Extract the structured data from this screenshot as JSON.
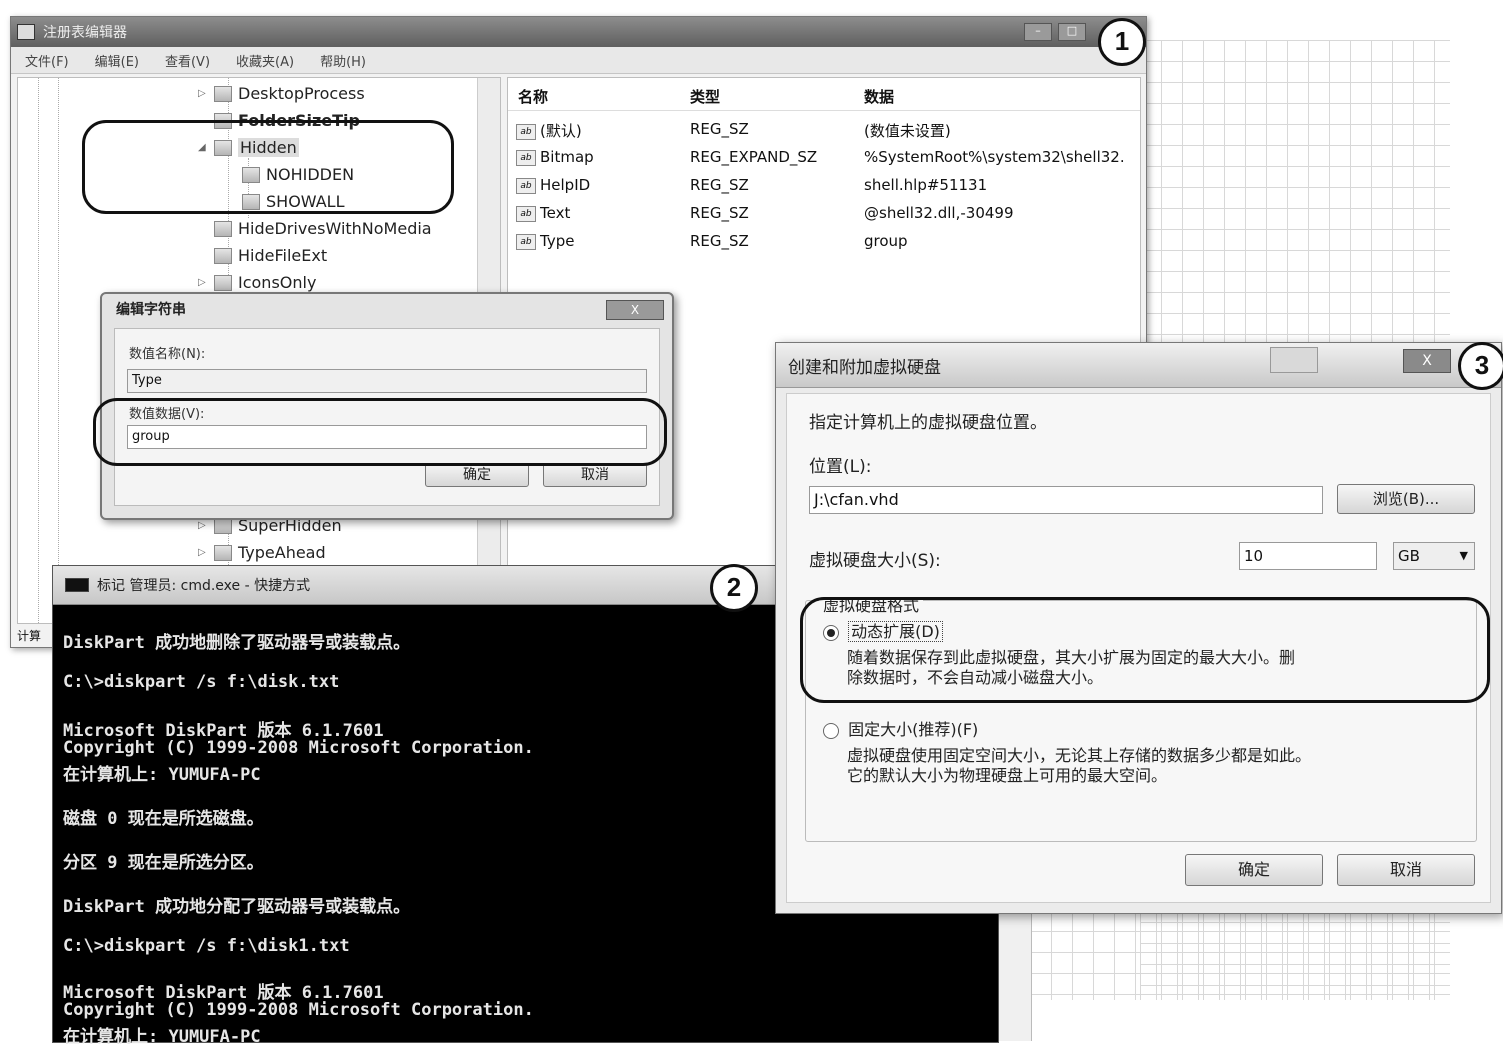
{
  "badges": {
    "one": "1",
    "two": "2",
    "three": "3"
  },
  "regedit": {
    "title": "注册表编辑器",
    "menu": [
      "文件(F)",
      "编辑(E)",
      "查看(V)",
      "收藏夹(A)",
      "帮助(H)"
    ],
    "tree": [
      "DesktopProcess",
      "FolderSizeTip",
      "Hidden",
      "NOHIDDEN",
      "SHOWALL",
      "HideDrivesWithNoMedia",
      "HideFileExt",
      "IconsOnly",
      "SuperHidden",
      "TypeAhead"
    ],
    "columns": {
      "name": "名称",
      "type": "类型",
      "data": "数据"
    },
    "rows": [
      {
        "name": "(默认)",
        "type": "REG_SZ",
        "data": "(数值未设置)"
      },
      {
        "name": "Bitmap",
        "type": "REG_EXPAND_SZ",
        "data": "%SystemRoot%\\system32\\shell32.",
        "icon": "ab"
      },
      {
        "name": "HelpID",
        "type": "REG_SZ",
        "data": "shell.hlp#51131"
      },
      {
        "name": "Text",
        "type": "REG_SZ",
        "data": "@shell32.dll,-30499"
      },
      {
        "name": "Type",
        "type": "REG_SZ",
        "data": "group"
      }
    ],
    "status": "计算"
  },
  "edit_string": {
    "title": "编辑字符串",
    "close": "X",
    "name_label": "数值名称(N):",
    "name_value": "Type",
    "data_label": "数值数据(V):",
    "data_value": "group",
    "ok": "确定",
    "cancel": "取消"
  },
  "cmd": {
    "title": "标记 管理员: cmd.exe - 快捷方式",
    "lines": [
      "DiskPart 成功地删除了驱动器号或装载点。",
      "C:\\>diskpart /s f:\\disk.txt",
      "Microsoft DiskPart 版本 6.1.7601",
      "Copyright (C) 1999-2008 Microsoft Corporation.",
      "在计算机上: YUMUFA-PC",
      "磁盘 0 现在是所选磁盘。",
      "分区 9 现在是所选分区。",
      "DiskPart 成功地分配了驱动器号或装载点。",
      "C:\\>diskpart /s f:\\disk1.txt",
      "Microsoft DiskPart 版本 6.1.7601",
      "Copyright (C) 1999-2008 Microsoft Corporation.",
      "在计算机上: YUMUFA-PC"
    ]
  },
  "vhd": {
    "title": "创建和附加虚拟硬盘",
    "close": "X",
    "instruction": "指定计算机上的虚拟硬盘位置。",
    "location_label": "位置(L):",
    "location_value": "J:\\cfan.vhd",
    "browse": "浏览(B)...",
    "size_label": "虚拟硬盘大小(S):",
    "size_value": "10",
    "size_unit": "GB",
    "format_group": "虚拟硬盘格式",
    "dynamic_label": "动态扩展(D)",
    "dynamic_desc_1": "随着数据保存到此虚拟硬盘，其大小扩展为固定的最大大小。删",
    "dynamic_desc_2": "除数据时，不会自动减小磁盘大小。",
    "fixed_label": "固定大小(推荐)(F)",
    "fixed_desc_1": "虚拟硬盘使用固定空间大小，无论其上存储的数据多少都是如此。",
    "fixed_desc_2": "它的默认大小为物理硬盘上可用的最大空间。",
    "ok": "确定",
    "cancel": "取消"
  }
}
